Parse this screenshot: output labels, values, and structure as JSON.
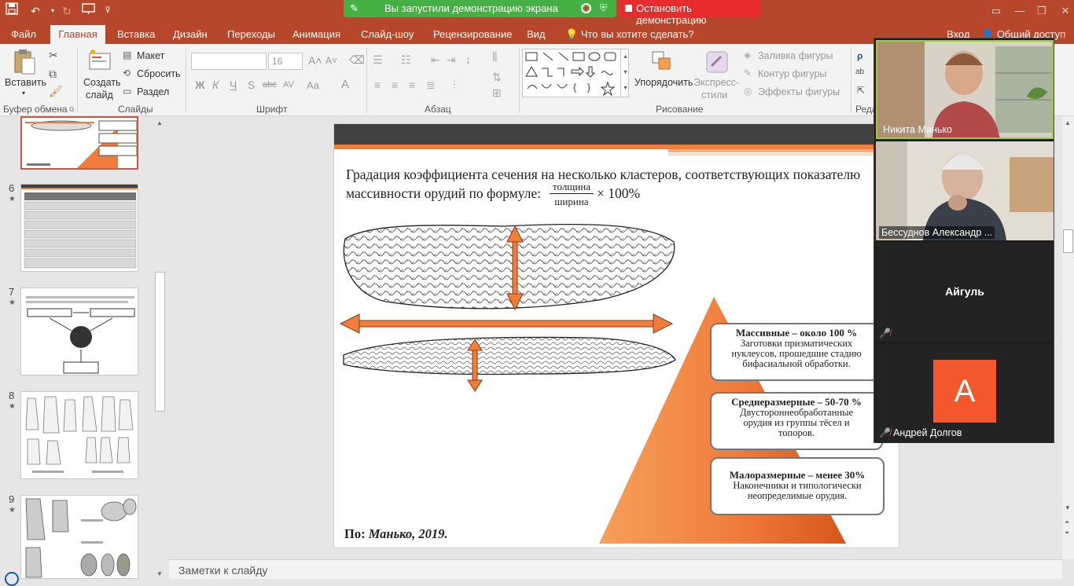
{
  "title_bar": {
    "save_icon": "save-icon",
    "undo_icon": "undo-icon",
    "redo_icon": "redo-icon",
    "present_icon": "present-from-start-icon",
    "customize_icon": "customize-quick-access-icon"
  },
  "screen_share": {
    "status_text": "Вы запустили демонстрацию экрана",
    "stop_label": "Остановить демонстрацию",
    "colors": {
      "active": "#45b043",
      "stop": "#e62c2c"
    }
  },
  "tabs": [
    {
      "label": "Файл"
    },
    {
      "label": "Главная"
    },
    {
      "label": "Вставка"
    },
    {
      "label": "Дизайн"
    },
    {
      "label": "Переходы"
    },
    {
      "label": "Анимация"
    },
    {
      "label": "Слайд-шоу"
    },
    {
      "label": "Рецензирование"
    },
    {
      "label": "Вид"
    }
  ],
  "tell_me": "Что вы хотите сделать?",
  "account": {
    "login": "Вход",
    "share": "Общий доступ"
  },
  "ribbon": {
    "clipboard": {
      "label": "Буфер обмена",
      "paste": "Вставить"
    },
    "slides": {
      "label": "Слайды",
      "new_slide_1": "Создать",
      "new_slide_2": "слайд",
      "layout": "Макет",
      "reset": "Сбросить",
      "section": "Раздел"
    },
    "font": {
      "label": "Шрифт",
      "size": "16",
      "bold": "Ж",
      "italic": "К",
      "underline": "Ч",
      "shadow": "S",
      "strike": "abc",
      "spacing": "AV",
      "case": "Aa",
      "color": "A"
    },
    "paragraph": {
      "label": "Абзац"
    },
    "drawing": {
      "label": "Рисование",
      "arrange": "Упорядочить",
      "quick_styles_1": "Экспресс-",
      "quick_styles_2": "стили",
      "fill": "Заливка фигуры",
      "outline": "Контур фигуры",
      "effects": "Эффекты фигуры"
    },
    "editing": {
      "label": "Реда"
    }
  },
  "thumbnails": [
    {
      "number": "6"
    },
    {
      "number": "7"
    },
    {
      "number": "8"
    },
    {
      "number": "9"
    }
  ],
  "slide": {
    "text_line1": "Градация коэффициента сечения на несколько кластеров, соответствующих показателю",
    "text_line2_prefix": "массивности орудий по формуле:",
    "fraction_numerator": "толщина",
    "fraction_denominator": "ширина",
    "formula_suffix": "× 100%",
    "cards": [
      {
        "title": "Массивные – около 100 %",
        "body_1": "Заготовки призматических",
        "body_2": "нуклеусов, прошедшие стадию",
        "body_3": "бифасиальной обработки."
      },
      {
        "title": "Среднеразмерные – 50-70 %",
        "body_1": "Двусторонне­обработанные",
        "body_2": "орудия из группы тёсел и",
        "body_3": "топоров."
      },
      {
        "title": "Малоразмерные – менее 30%",
        "body_1": "Наконечники и типологически",
        "body_2": "неопределимые орудия.",
        "body_3": ""
      }
    ],
    "citation_prefix": "По:",
    "citation_source": "Манько, 2019.",
    "colors": {
      "accent": "#f07d3c",
      "dark_band": "#404040"
    }
  },
  "notes_placeholder": "Заметки к слайду",
  "participants": [
    {
      "name": "Никита Манько",
      "video": true
    },
    {
      "name": "Бессуднов Александр ...",
      "video": true
    },
    {
      "name": "Айгуль",
      "video": false,
      "muted": true
    },
    {
      "name": "Андрей Долгов",
      "video": false,
      "muted": true,
      "avatar_letter": "А",
      "avatar_color": "#f2572e"
    }
  ]
}
